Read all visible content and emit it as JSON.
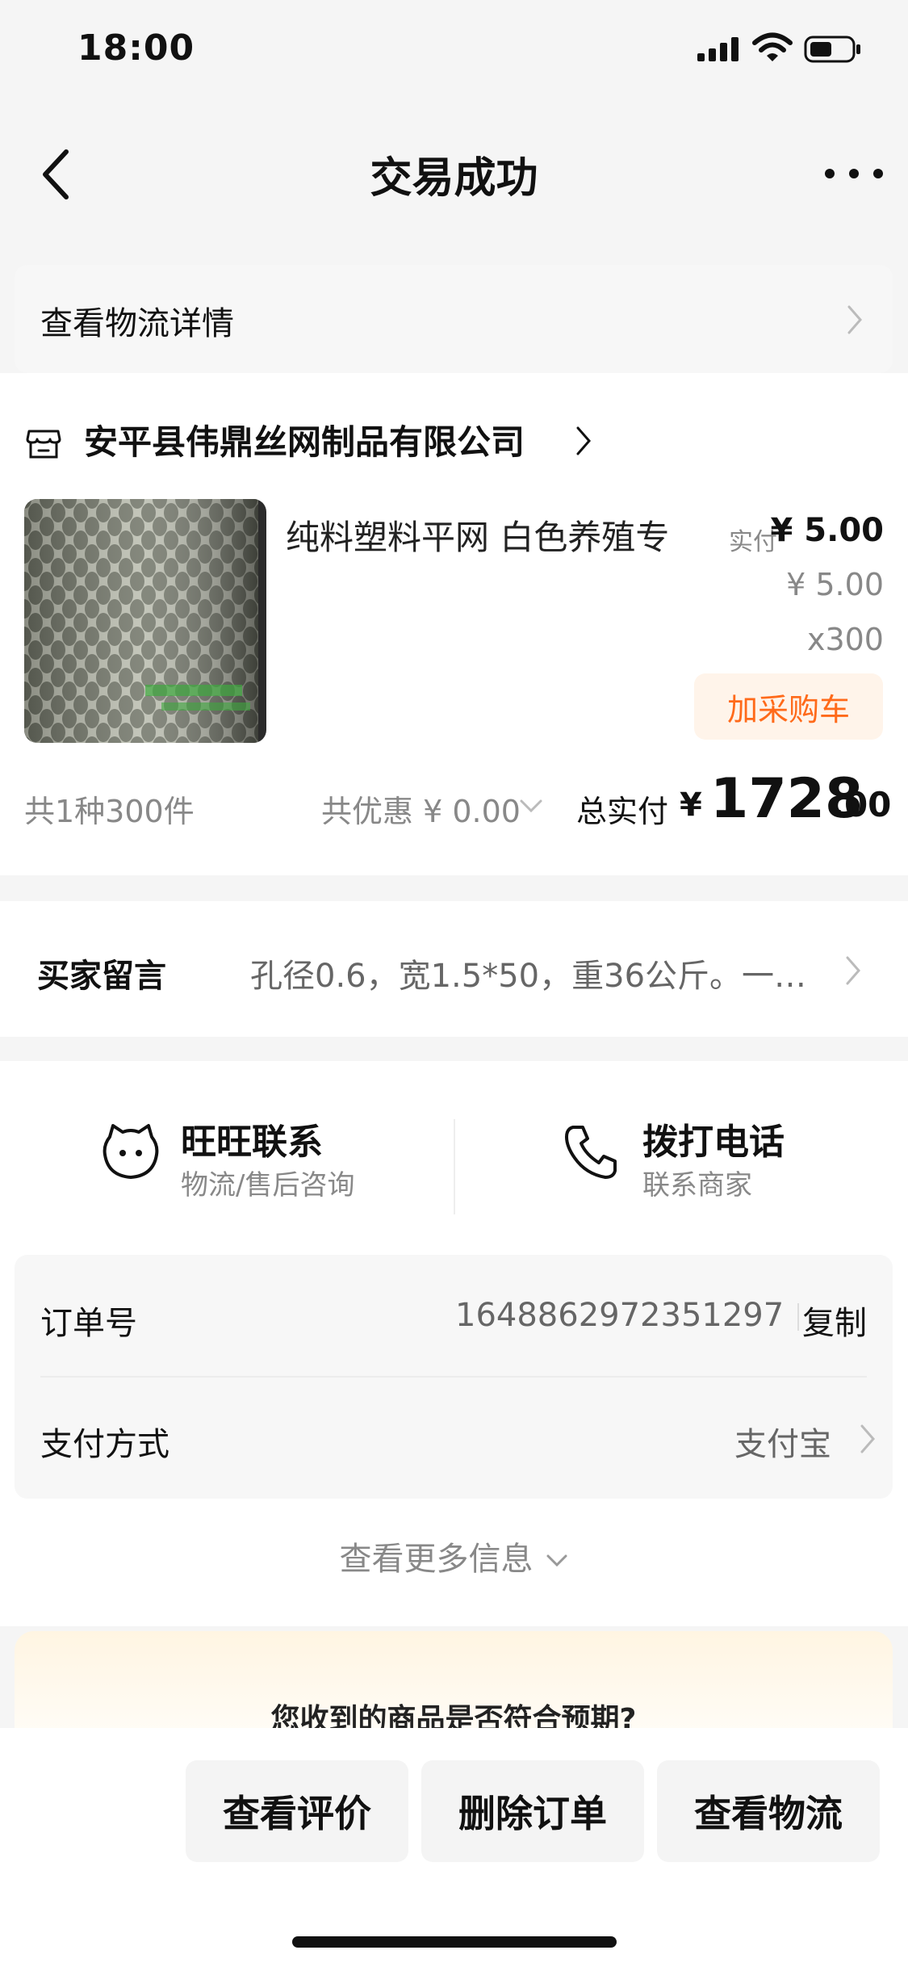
{
  "status_bar": {
    "time": "18:00"
  },
  "nav": {
    "title": "交易成功"
  },
  "logistics": {
    "label": "查看物流详情"
  },
  "order": {
    "shop_name": "安平县伟鼎丝网制品有限公司",
    "product_name": "纯料塑料平网 白色养殖专",
    "price_label": "实付",
    "price_actual": "¥ 5.00",
    "price_original": "¥ 5.00",
    "quantity": "x300",
    "add_cart_label": "加采购车",
    "summary_count": "共1种300件",
    "summary_discount": "共优惠 ¥ 0.00",
    "total_label": "总实付",
    "total_currency": "¥",
    "total_integer": "1728",
    "total_decimal": ".00"
  },
  "message": {
    "label": "买家留言",
    "text": "孔径0.6，宽1.5*50，重36公斤。一…"
  },
  "contact": {
    "wangwang_title": "旺旺联系",
    "wangwang_sub": "物流/售后咨询",
    "phone_title": "拨打电话",
    "phone_sub": "联系商家"
  },
  "info": {
    "order_no_label": "订单号",
    "order_no_value": "1648862972351297",
    "copy_label": "复制",
    "payment_label": "支付方式",
    "payment_value": "支付宝",
    "more_info_label": "查看更多信息"
  },
  "survey": {
    "question": "您收到的商品是否符合预期?"
  },
  "actions": {
    "view_review": "查看评价",
    "delete_order": "删除订单",
    "view_logistics": "查看物流"
  },
  "colors": {
    "accent": "#ff6a1a",
    "accent_bg": "#fff4ea",
    "page_bg": "#f5f5f5"
  }
}
